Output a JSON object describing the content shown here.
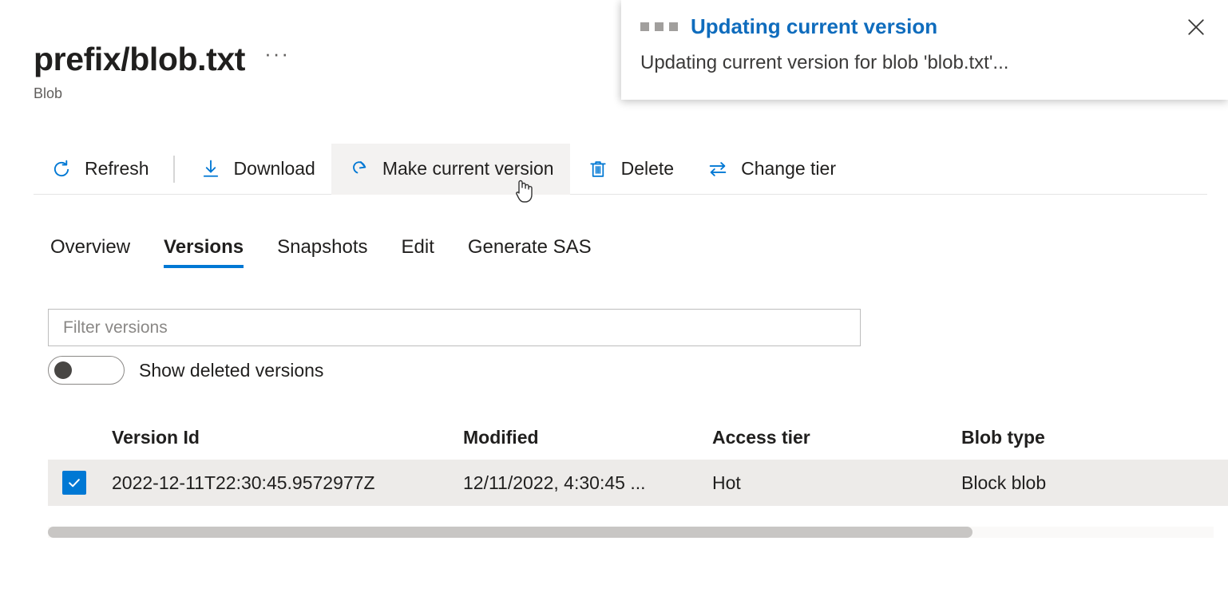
{
  "header": {
    "title": "prefix/blob.txt",
    "subtitle": "Blob",
    "more_label": "···"
  },
  "command_bar": {
    "buttons": [
      {
        "label": "Refresh",
        "icon": "refresh-icon"
      },
      {
        "label": "Download",
        "icon": "download-icon"
      },
      {
        "label": "Make current version",
        "icon": "redo-icon",
        "hovered": true
      },
      {
        "label": "Delete",
        "icon": "trash-icon"
      },
      {
        "label": "Change tier",
        "icon": "swap-arrows-icon"
      }
    ]
  },
  "tabs": [
    {
      "label": "Overview",
      "active": false
    },
    {
      "label": "Versions",
      "active": true
    },
    {
      "label": "Snapshots",
      "active": false
    },
    {
      "label": "Edit",
      "active": false
    },
    {
      "label": "Generate SAS",
      "active": false
    }
  ],
  "filter": {
    "value": "",
    "placeholder": "Filter versions"
  },
  "toggle": {
    "label": "Show deleted versions",
    "state": "off"
  },
  "table": {
    "columns": [
      "Version Id",
      "Modified",
      "Access tier",
      "Blob type"
    ],
    "rows": [
      {
        "selected": true,
        "version_id": "2022-12-11T22:30:45.9572977Z",
        "modified": "12/11/2022, 4:30:45 ...",
        "access_tier": "Hot",
        "blob_type": "Block blob"
      }
    ]
  },
  "notification": {
    "title": "Updating current version",
    "body": "Updating current version for blob 'blob.txt'...",
    "close_label": "Close"
  },
  "colors": {
    "accent": "#0078d4",
    "link": "#0f6cbd",
    "row_selected": "#edebe9",
    "hover": "#f3f2f1"
  }
}
